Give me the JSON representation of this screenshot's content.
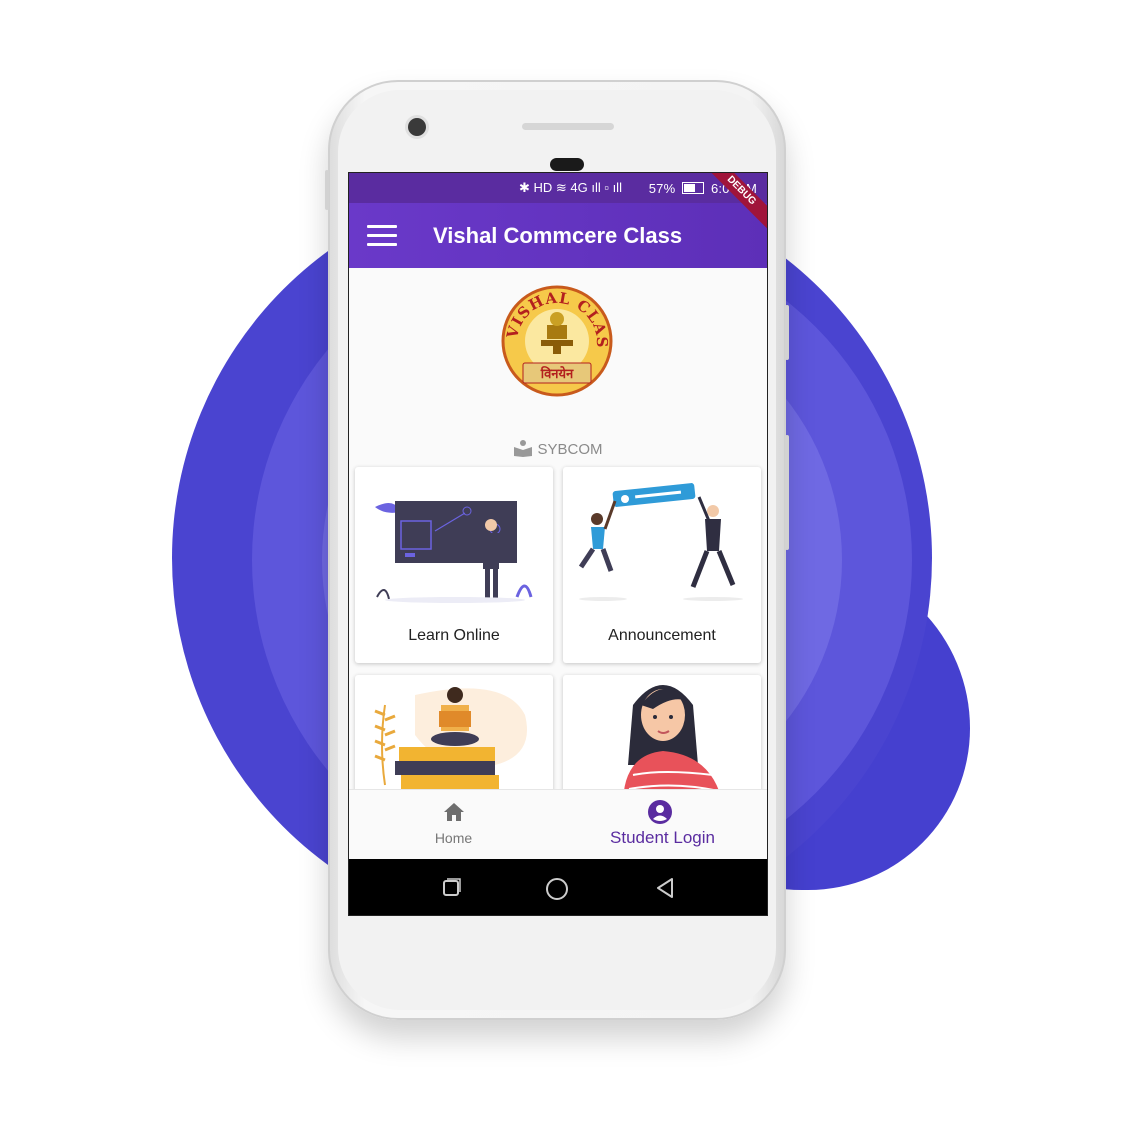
{
  "status_bar": {
    "icons": "✱ HD ≋ 4G ıll ▫ ıll",
    "battery": "57%",
    "time": "6:04PM",
    "debug_label": "DEBUG"
  },
  "app_bar": {
    "title": "Vishal Commcere Class",
    "menu_icon": "hamburger-menu-icon"
  },
  "logo": {
    "text_top": "VISHAL CLASSES",
    "text_bottom": "विनयेन"
  },
  "section": {
    "label": "SYBCOM",
    "icon": "book-reader-icon"
  },
  "cards": [
    {
      "label": "Learn Online"
    },
    {
      "label": "Announcement"
    },
    {
      "label": ""
    },
    {
      "label": ""
    }
  ],
  "bottom_nav": {
    "items": [
      {
        "label": "Home",
        "icon": "home-icon"
      },
      {
        "label": "Student Login",
        "icon": "account-circle-icon"
      }
    ]
  },
  "system_nav": [
    "recents-icon",
    "home-circle-icon",
    "back-icon"
  ],
  "colors": {
    "primary": "#5a2ca0",
    "app_bar": "#6a39c9",
    "background_blob": "#4a44d0"
  }
}
